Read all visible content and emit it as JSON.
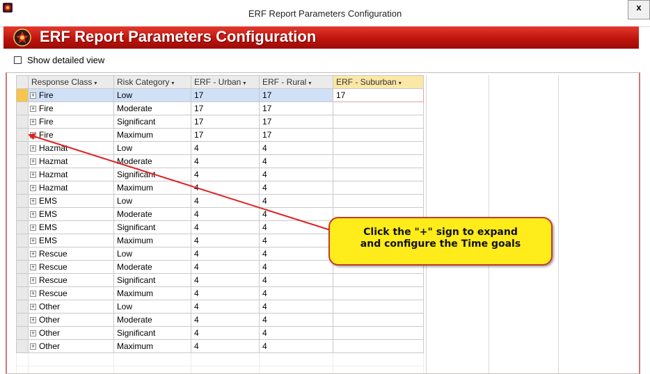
{
  "window": {
    "title": "ERF Report Parameters Configuration",
    "close_label": "x"
  },
  "banner": {
    "title": "ERF Report Parameters Configuration"
  },
  "options": {
    "show_detailed_view_label": "Show detailed view",
    "show_detailed_view_checked": false
  },
  "grid": {
    "columns": [
      "Response Class",
      "Risk Category",
      "ERF - Urban",
      "ERF - Rural",
      "ERF - Suburban"
    ],
    "sort_glyph": "▾",
    "expand_glyph": "+",
    "rows": [
      [
        "Fire",
        "Low",
        "17",
        "17",
        "17"
      ],
      [
        "Fire",
        "Moderate",
        "17",
        "17",
        ""
      ],
      [
        "Fire",
        "Significant",
        "17",
        "17",
        ""
      ],
      [
        "Fire",
        "Maximum",
        "17",
        "17",
        ""
      ],
      [
        "Hazmat",
        "Low",
        "4",
        "4",
        ""
      ],
      [
        "Hazmat",
        "Moderate",
        "4",
        "4",
        ""
      ],
      [
        "Hazmat",
        "Significant",
        "4",
        "4",
        ""
      ],
      [
        "Hazmat",
        "Maximum",
        "4",
        "4",
        ""
      ],
      [
        "EMS",
        "Low",
        "4",
        "4",
        ""
      ],
      [
        "EMS",
        "Moderate",
        "4",
        "4",
        ""
      ],
      [
        "EMS",
        "Significant",
        "4",
        "4",
        ""
      ],
      [
        "EMS",
        "Maximum",
        "4",
        "4",
        ""
      ],
      [
        "Rescue",
        "Low",
        "4",
        "4",
        ""
      ],
      [
        "Rescue",
        "Moderate",
        "4",
        "4",
        ""
      ],
      [
        "Rescue",
        "Significant",
        "4",
        "4",
        ""
      ],
      [
        "Rescue",
        "Maximum",
        "4",
        "4",
        ""
      ],
      [
        "Other",
        "Low",
        "4",
        "4",
        ""
      ],
      [
        "Other",
        "Moderate",
        "4",
        "4",
        ""
      ],
      [
        "Other",
        "Significant",
        "4",
        "4",
        ""
      ],
      [
        "Other",
        "Maximum",
        "4",
        "4",
        ""
      ]
    ]
  },
  "callout": {
    "line1": "Click the \"+\" sign to expand",
    "line2": "and configure the Time goals"
  },
  "colors": {
    "banner": "#c0140d",
    "callout_fill": "#ffec1a",
    "callout_border": "#c33b2b",
    "arrow": "#e02020",
    "selected_row": "#cfe0f7"
  }
}
